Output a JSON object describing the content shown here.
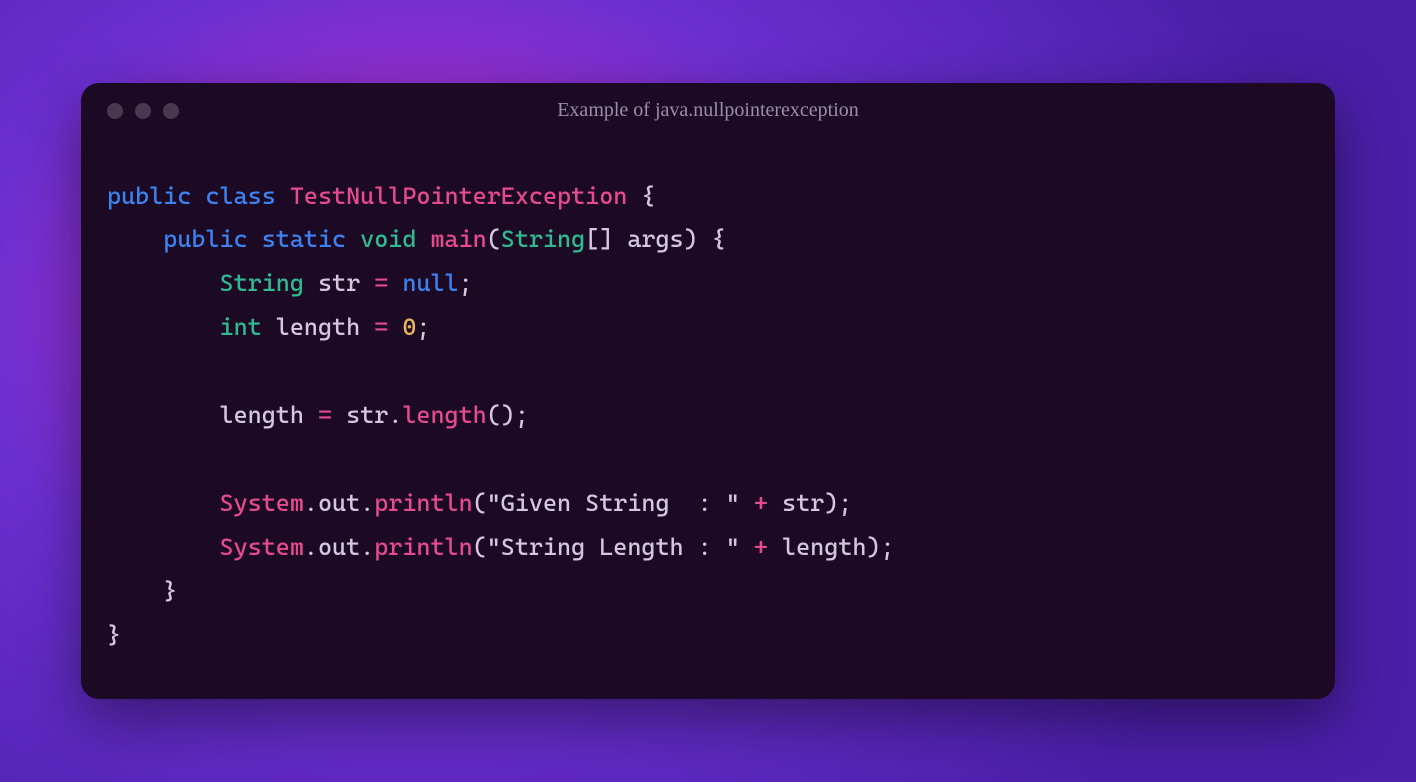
{
  "window": {
    "title": "Example of java.nullpointerexception"
  },
  "code": {
    "tokens": [
      [
        [
          "kw",
          "public"
        ],
        [
          "punc",
          " "
        ],
        [
          "class",
          "class"
        ],
        [
          "punc",
          " "
        ],
        [
          "typeN",
          "TestNullPointerException"
        ],
        [
          "punc",
          " {"
        ]
      ],
      [
        [
          "punc",
          "    "
        ],
        [
          "kw",
          "public"
        ],
        [
          "punc",
          " "
        ],
        [
          "kw",
          "static"
        ],
        [
          "punc",
          " "
        ],
        [
          "type",
          "void"
        ],
        [
          "punc",
          " "
        ],
        [
          "fn",
          "main"
        ],
        [
          "punc",
          "("
        ],
        [
          "type",
          "String"
        ],
        [
          "punc",
          "[] "
        ],
        [
          "var",
          "args"
        ],
        [
          "punc",
          ") {"
        ]
      ],
      [
        [
          "punc",
          "        "
        ],
        [
          "type",
          "String"
        ],
        [
          "punc",
          " "
        ],
        [
          "var",
          "str"
        ],
        [
          "punc",
          " "
        ],
        [
          "op",
          "="
        ],
        [
          "punc",
          " "
        ],
        [
          "null",
          "null"
        ],
        [
          "punc",
          ";"
        ]
      ],
      [
        [
          "punc",
          "        "
        ],
        [
          "type",
          "int"
        ],
        [
          "punc",
          " "
        ],
        [
          "var",
          "length"
        ],
        [
          "punc",
          " "
        ],
        [
          "op",
          "="
        ],
        [
          "punc",
          " "
        ],
        [
          "num",
          "0"
        ],
        [
          "punc",
          ";"
        ]
      ],
      [
        [
          "punc",
          ""
        ]
      ],
      [
        [
          "punc",
          "        "
        ],
        [
          "var",
          "length"
        ],
        [
          "punc",
          " "
        ],
        [
          "op",
          "="
        ],
        [
          "punc",
          " "
        ],
        [
          "var",
          "str"
        ],
        [
          "punc",
          "."
        ],
        [
          "fn",
          "length"
        ],
        [
          "punc",
          "();"
        ]
      ],
      [
        [
          "punc",
          ""
        ]
      ],
      [
        [
          "punc",
          "        "
        ],
        [
          "typeN",
          "System"
        ],
        [
          "punc",
          "."
        ],
        [
          "var",
          "out"
        ],
        [
          "punc",
          "."
        ],
        [
          "fn",
          "println"
        ],
        [
          "punc",
          "("
        ],
        [
          "str",
          "\"Given String  : \""
        ],
        [
          "punc",
          " "
        ],
        [
          "op",
          "+"
        ],
        [
          "punc",
          " "
        ],
        [
          "var",
          "str"
        ],
        [
          "punc",
          ");"
        ]
      ],
      [
        [
          "punc",
          "        "
        ],
        [
          "typeN",
          "System"
        ],
        [
          "punc",
          "."
        ],
        [
          "var",
          "out"
        ],
        [
          "punc",
          "."
        ],
        [
          "fn",
          "println"
        ],
        [
          "punc",
          "("
        ],
        [
          "str",
          "\"String Length : \""
        ],
        [
          "punc",
          " "
        ],
        [
          "op",
          "+"
        ],
        [
          "punc",
          " "
        ],
        [
          "var",
          "length"
        ],
        [
          "punc",
          ");"
        ]
      ],
      [
        [
          "punc",
          "    }"
        ]
      ],
      [
        [
          "punc",
          "}"
        ]
      ]
    ]
  }
}
